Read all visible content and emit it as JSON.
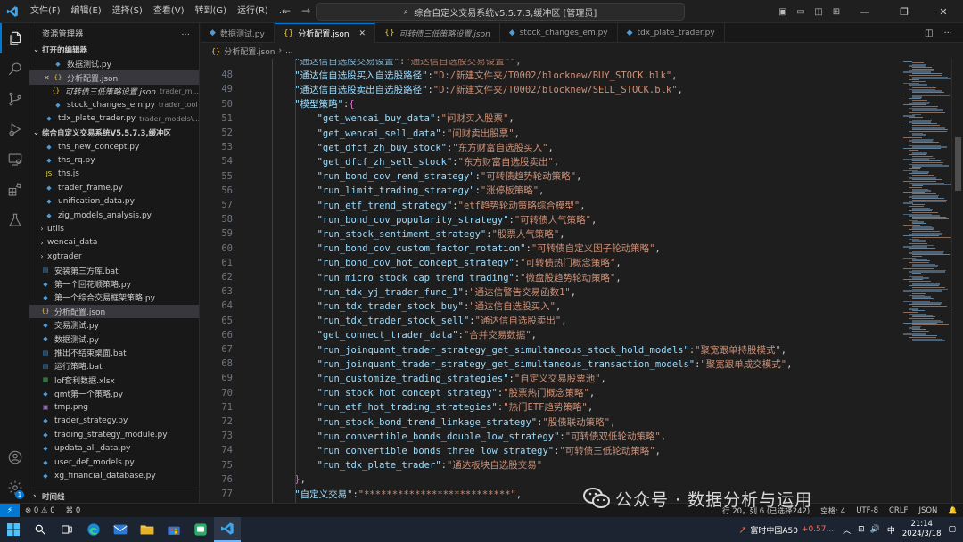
{
  "titlebar": {
    "menu": [
      "文件(F)",
      "编辑(E)",
      "选择(S)",
      "查看(V)",
      "转到(G)",
      "运行(R)",
      "..."
    ],
    "search_text": "综合自定义交易系统v5.5.7.3,缓冲区 [管理员]"
  },
  "sidebar": {
    "title": "资源管理器",
    "more": "...",
    "open_editors_label": "打开的编辑器",
    "open_editors": [
      {
        "name": "数据测试.py",
        "type": "py",
        "hint": "",
        "dirty": false,
        "selected": false
      },
      {
        "name": "分析配置.json",
        "type": "json",
        "hint": "",
        "dirty": true,
        "selected": true
      },
      {
        "name": "可转债三低策略设置.json",
        "type": "json",
        "hint": "trader_m...",
        "dirty": false,
        "selected": false,
        "italic": true
      },
      {
        "name": "stock_changes_em.py",
        "type": "py",
        "hint": "trader_tool",
        "dirty": false,
        "selected": false
      },
      {
        "name": "tdx_plate_trader.py",
        "type": "py",
        "hint": "trader_models\\...",
        "dirty": false,
        "selected": false
      }
    ],
    "project_label": "综合自定义交易系统V5.5.7.3,缓冲区",
    "tree": [
      {
        "name": "ths_new_concept.py",
        "type": "py",
        "indent": 2
      },
      {
        "name": "ths_rq.py",
        "type": "py",
        "indent": 2
      },
      {
        "name": "ths.js",
        "type": "js",
        "indent": 2
      },
      {
        "name": "trader_frame.py",
        "type": "py",
        "indent": 2
      },
      {
        "name": "unification_data.py",
        "type": "py",
        "indent": 2
      },
      {
        "name": "zig_models_analysis.py",
        "type": "py",
        "indent": 2
      },
      {
        "name": "utils",
        "type": "folder",
        "indent": 1
      },
      {
        "name": "wencai_data",
        "type": "folder",
        "indent": 1
      },
      {
        "name": "xgtrader",
        "type": "folder",
        "indent": 1
      },
      {
        "name": "安装第三方库.bat",
        "type": "bat",
        "indent": 1
      },
      {
        "name": "第一个回花顺策略.py",
        "type": "py",
        "indent": 1
      },
      {
        "name": "第一个综合交易框架策略.py",
        "type": "py",
        "indent": 1
      },
      {
        "name": "分析配置.json",
        "type": "json",
        "indent": 1,
        "selected": true
      },
      {
        "name": "交易测试.py",
        "type": "py",
        "indent": 1
      },
      {
        "name": "数据测试.py",
        "type": "py",
        "indent": 1
      },
      {
        "name": "推出不结束桌面.bat",
        "type": "bat",
        "indent": 1
      },
      {
        "name": "运行策略.bat",
        "type": "bat",
        "indent": 1
      },
      {
        "name": "lof套利数据.xlsx",
        "type": "xlsx",
        "indent": 1
      },
      {
        "name": "qmt第一个策略.py",
        "type": "py",
        "indent": 1
      },
      {
        "name": "tmp.png",
        "type": "png",
        "indent": 1
      },
      {
        "name": "trader_strategy.py",
        "type": "py",
        "indent": 1
      },
      {
        "name": "trading_strategy_module.py",
        "type": "py",
        "indent": 1
      },
      {
        "name": "updata_all_data.py",
        "type": "py",
        "indent": 1
      },
      {
        "name": "user_def_models.py",
        "type": "py",
        "indent": 1
      },
      {
        "name": "xg_financial_database.py",
        "type": "py",
        "indent": 1
      }
    ],
    "timeline_label": "时间线"
  },
  "tabs": [
    {
      "label": "数据测试.py",
      "type": "py",
      "active": false,
      "italic": false
    },
    {
      "label": "分析配置.json",
      "type": "json",
      "active": true,
      "italic": false
    },
    {
      "label": "可转债三低策略设置.json",
      "type": "json",
      "active": false,
      "italic": true
    },
    {
      "label": "stock_changes_em.py",
      "type": "py",
      "active": false,
      "italic": false
    },
    {
      "label": "tdx_plate_trader.py",
      "type": "py",
      "active": false,
      "italic": false
    }
  ],
  "breadcrumb": "分析配置.json",
  "editor": {
    "lines": [
      {
        "n": "",
        "indent": 4,
        "key": "通达信自选股交易设置",
        "sep": "\":",
        "val": "通达信自选股交易设置",
        "tail": "\",",
        "partial": true
      },
      {
        "n": "48",
        "indent": 4,
        "key": "通达信自选股买入自选股路径",
        "val": "D:/新建文件夹/T0002/blocknew/BUY_STOCK.blk",
        "tail": ","
      },
      {
        "n": "49",
        "indent": 4,
        "key": "通达信自选股卖出自选股路径",
        "val": "D:/新建文件夹/T0002/blocknew/SELL_STOCK.blk",
        "tail": ","
      },
      {
        "n": "50",
        "indent": 4,
        "key": "模型策略",
        "open": "{"
      },
      {
        "n": "51",
        "indent": 8,
        "key": "get_wencai_buy_data",
        "val": "问财买入股票",
        "tail": ","
      },
      {
        "n": "52",
        "indent": 8,
        "key": "get_wencai_sell_data",
        "val": "问财卖出股票",
        "tail": ","
      },
      {
        "n": "53",
        "indent": 8,
        "key": "get_dfcf_zh_buy_stock",
        "val": "东方财富自选股买入",
        "tail": ","
      },
      {
        "n": "54",
        "indent": 8,
        "key": "get_dfcf_zh_sell_stock",
        "val": "东方财富自选股卖出",
        "tail": ","
      },
      {
        "n": "55",
        "indent": 8,
        "key": "run_bond_cov_rend_strategy",
        "val": "可转债趋势轮动策略",
        "tail": ","
      },
      {
        "n": "56",
        "indent": 8,
        "key": "run_limit_trading_strategy",
        "val": "涨停板策略",
        "tail": ","
      },
      {
        "n": "57",
        "indent": 8,
        "key": "run_etf_trend_strategy",
        "val": "etf趋势轮动策略综合模型",
        "tail": ","
      },
      {
        "n": "58",
        "indent": 8,
        "key": "run_bond_cov_popularity_strategy",
        "val": "可转债人气策略",
        "tail": ","
      },
      {
        "n": "59",
        "indent": 8,
        "key": "run_stock_sentiment_strategy",
        "val": "股票人气策略",
        "tail": ","
      },
      {
        "n": "60",
        "indent": 8,
        "key": "run_bond_cov_custom_factor_rotation",
        "val": "可转债自定义因子轮动策略",
        "tail": ","
      },
      {
        "n": "61",
        "indent": 8,
        "key": "run_bond_cov_hot_concept_strategy",
        "val": "可转债热门概念策略",
        "tail": ","
      },
      {
        "n": "62",
        "indent": 8,
        "key": "run_micro_stock_cap_trend_trading",
        "val": "微盘股趋势轮动策略",
        "tail": ","
      },
      {
        "n": "63",
        "indent": 8,
        "key": "run_tdx_yj_trader_func_1",
        "val": "通达信警告交易函数1",
        "tail": ","
      },
      {
        "n": "64",
        "indent": 8,
        "key": "run_tdx_trader_stock_buy",
        "val": "通达信自选股买入",
        "tail": ","
      },
      {
        "n": "65",
        "indent": 8,
        "key": "run_tdx_trader_stock_sell",
        "val": "通达信自选股卖出",
        "tail": ","
      },
      {
        "n": "66",
        "indent": 8,
        "key": "get_connect_trader_data",
        "val": "合并交易数据",
        "tail": ","
      },
      {
        "n": "67",
        "indent": 8,
        "key": "run_joinquant_trader_strategy_get_simultaneous_stock_hold_models",
        "val": "聚宽跟单持股模式",
        "tail": ","
      },
      {
        "n": "68",
        "indent": 8,
        "key": "run_joinquant_trader_strategy_get_simultaneous_transaction_models",
        "val": "聚宽跟单成交模式",
        "tail": ","
      },
      {
        "n": "69",
        "indent": 8,
        "key": "run_customize_trading_strategies",
        "val": "自定义交易股票池",
        "tail": ","
      },
      {
        "n": "70",
        "indent": 8,
        "key": "run_stock_hot_concept_strategy",
        "val": "股票热门概念策略",
        "tail": ","
      },
      {
        "n": "71",
        "indent": 8,
        "key": "run_etf_hot_trading_strategies",
        "val": "热门ETF趋势策略",
        "tail": ","
      },
      {
        "n": "72",
        "indent": 8,
        "key": "run_stock_bond_trend_linkage_strategy",
        "val": "股债联动策略",
        "tail": ","
      },
      {
        "n": "73",
        "indent": 8,
        "key": "run_convertible_bonds_double_low_strategy",
        "val": "可转债双低轮动策略",
        "tail": ","
      },
      {
        "n": "74",
        "indent": 8,
        "key": "run_convertible_bonds_three_low_strategy",
        "val": "可转债三低轮动策略",
        "tail": ","
      },
      {
        "n": "75",
        "indent": 8,
        "key": "run_tdx_plate_trader",
        "val": "通达板块自选股交易",
        "tail": ""
      },
      {
        "n": "76",
        "indent": 4,
        "close": "},"
      },
      {
        "n": "77",
        "indent": 4,
        "key": "自定义交易",
        "val": "**************************",
        "tail": ","
      },
      {
        "n": "78",
        "indent": 4,
        "key": "是否开启自定义函数模块",
        "val": "是",
        "tail": "",
        "partial": true
      }
    ]
  },
  "statusbar": {
    "errors": "⊗ 0 ⚠ 0",
    "ports": "⌘ 0",
    "position": "行 20，列 6 (已选择242)",
    "spaces": "空格: 4",
    "encoding": "UTF-8",
    "eol": "CRLF",
    "language": "JSON"
  },
  "taskbar": {
    "stock_name": "富时中国A50",
    "stock_change": "+0.57...",
    "ime": "中",
    "time": "21:14",
    "date": "2024/3/18"
  },
  "watermark": {
    "text": "公众号 · 数据分析与运用"
  }
}
